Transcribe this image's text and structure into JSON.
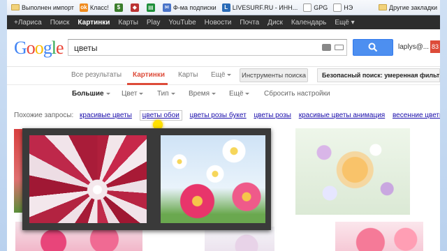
{
  "bookmarks": [
    {
      "label": "Выполнен импорт",
      "icon": "folder-icon"
    },
    {
      "label": "Класс!",
      "icon": "ok-icon",
      "color": "#f08b1d"
    },
    {
      "label": "",
      "icon": "dollar-icon",
      "color": "#3a7d2c"
    },
    {
      "label": "",
      "icon": "gift-icon",
      "color": "#b33"
    },
    {
      "label": "",
      "icon": "sheet-icon",
      "color": "#1f8f3a"
    },
    {
      "label": "Ф-ма подписки",
      "icon": "mail-icon",
      "color": "#4a74c9"
    },
    {
      "label": "LIVESURF.RU - ИНН...",
      "icon": "livesurf-icon",
      "color": "#2a6bb7"
    },
    {
      "label": "GPG",
      "icon": "page-icon",
      "color": "#999"
    },
    {
      "label": "НЭ",
      "icon": "page-icon",
      "color": "#999"
    }
  ],
  "bookmarks_other": "Другие закладки",
  "gbar": [
    "+Лариса",
    "Поиск",
    "Картинки",
    "Карты",
    "Play",
    "YouTube",
    "Новости",
    "Почта",
    "Диск",
    "Календарь",
    "Ещё ▾"
  ],
  "gbar_active": "Картинки",
  "search": {
    "query": "цветы",
    "user": "laplys@..."
  },
  "avatar_count": "83",
  "tabs": {
    "all": "Все результаты",
    "images": "Картинки",
    "maps": "Карты",
    "more": "Ещё",
    "tools": "Инструменты поиска",
    "safe": "Безопасный поиск: умеренная фильтрация"
  },
  "filters": {
    "size": "Большие",
    "color": "Цвет",
    "type": "Тип",
    "time": "Время",
    "more": "Ещё",
    "reset": "Сбросить настройки"
  },
  "related": {
    "label": "Похожие запросы:",
    "items": [
      "красивые цветы",
      "цветы обои",
      "цветы розы букет",
      "цветы розы",
      "красивые цветы анимация",
      "весенние цветы"
    ]
  }
}
